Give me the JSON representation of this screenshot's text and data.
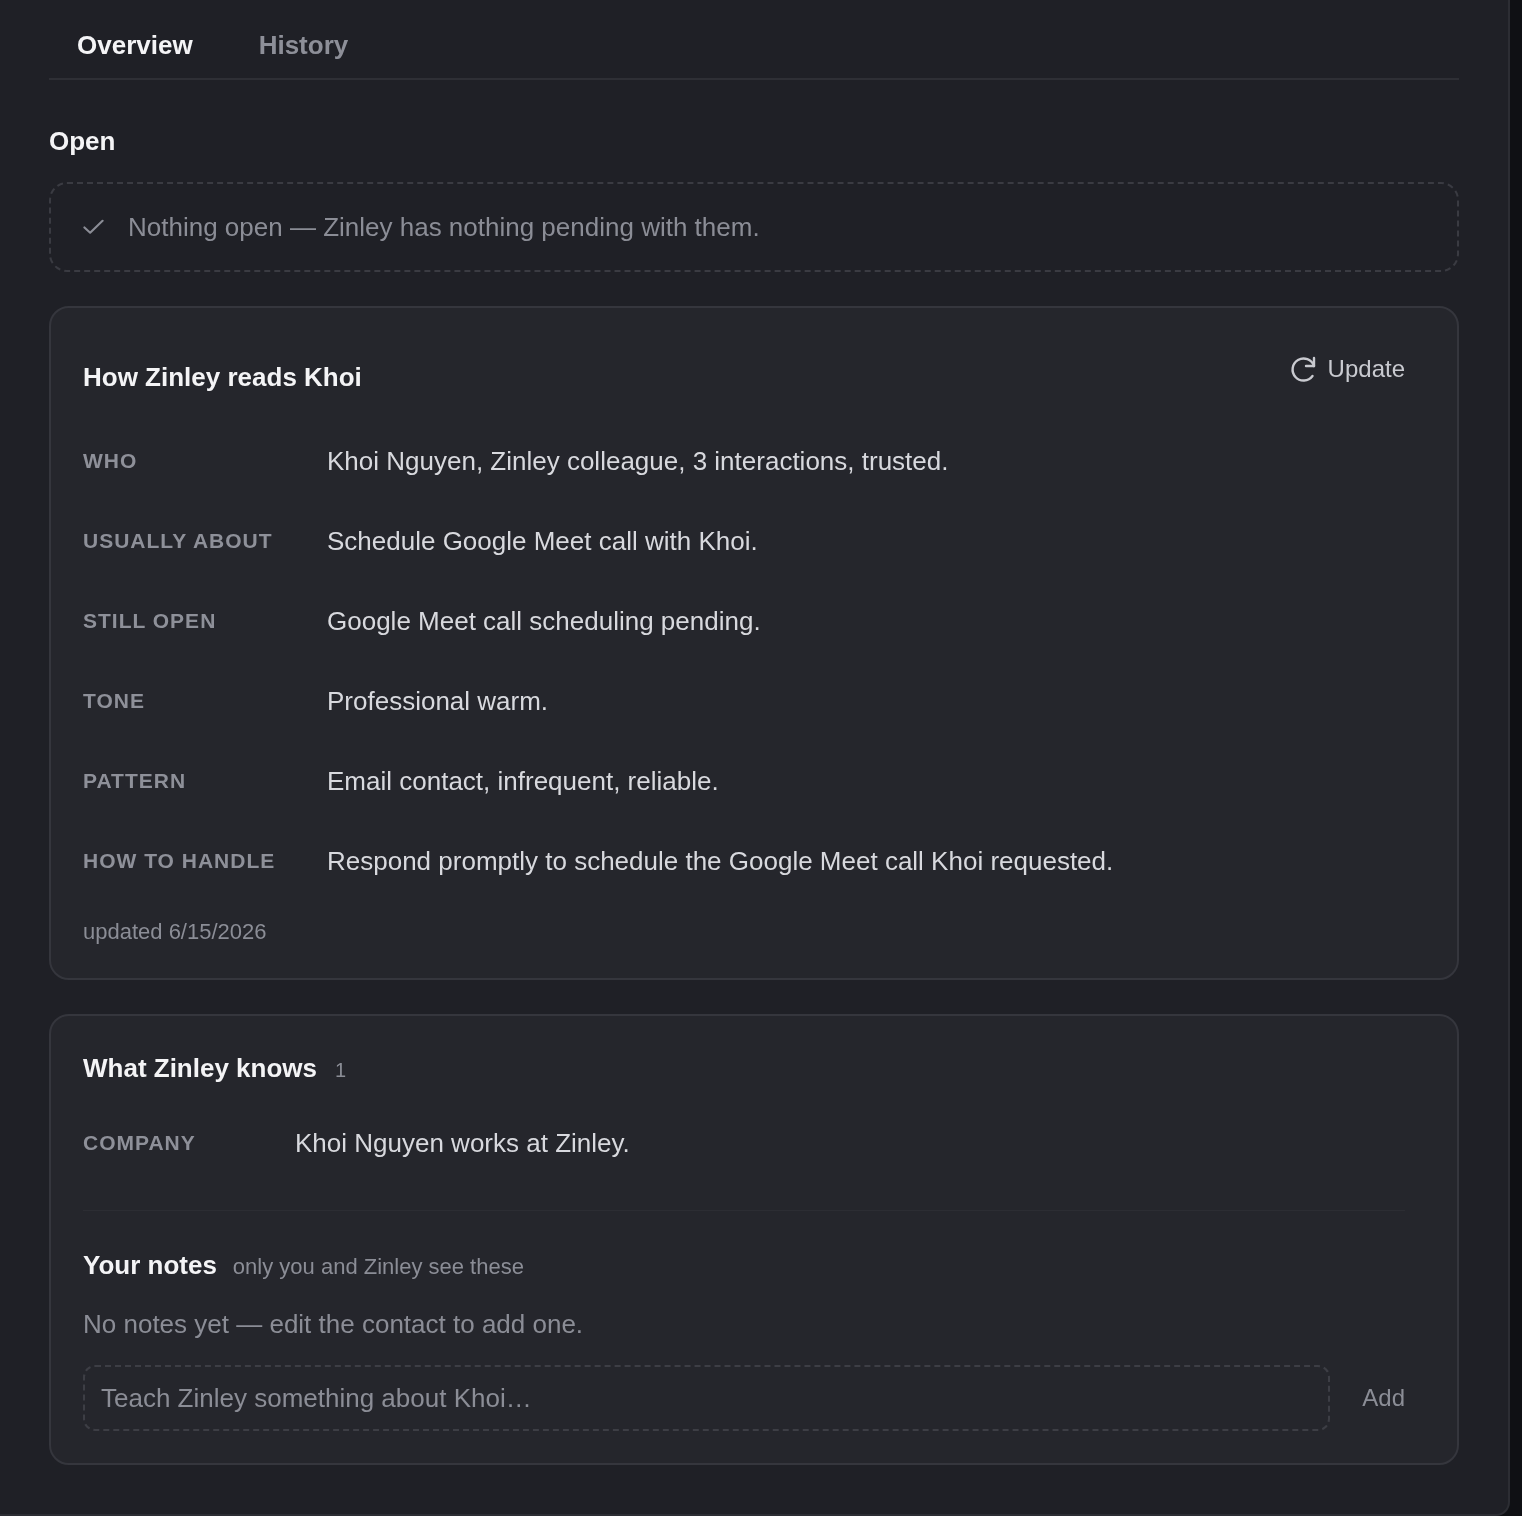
{
  "tabs": [
    {
      "label": "Overview",
      "selected": true
    },
    {
      "label": "History",
      "selected": false
    }
  ],
  "open": {
    "heading": "Open",
    "empty_message": "Nothing open — Zinley has nothing pending with them."
  },
  "reading": {
    "title": "How Zinley reads Khoi",
    "update_button": "Update",
    "rows": [
      {
        "label": "WHO",
        "value": "Khoi Nguyen, Zinley colleague, 3 interactions, trusted."
      },
      {
        "label": "USUALLY ABOUT",
        "value": "Schedule Google Meet call with Khoi."
      },
      {
        "label": "STILL OPEN",
        "value": "Google Meet call scheduling pending."
      },
      {
        "label": "TONE",
        "value": "Professional warm."
      },
      {
        "label": "PATTERN",
        "value": "Email contact, infrequent, reliable."
      },
      {
        "label": "HOW TO HANDLE",
        "value": "Respond promptly to schedule the Google Meet call Khoi requested."
      }
    ],
    "updated": "updated 6/15/2026"
  },
  "knowledge": {
    "title": "What Zinley knows",
    "count": "1",
    "facts": [
      {
        "label": "COMPANY",
        "value": "Khoi Nguyen works at Zinley."
      }
    ],
    "notes": {
      "heading": "Your notes",
      "subtitle": "only you and Zinley see these",
      "empty_message": "No notes yet — edit the contact to add one.",
      "input": {
        "placeholder": "Teach Zinley something about Khoi…"
      },
      "add_button": "Add"
    }
  }
}
